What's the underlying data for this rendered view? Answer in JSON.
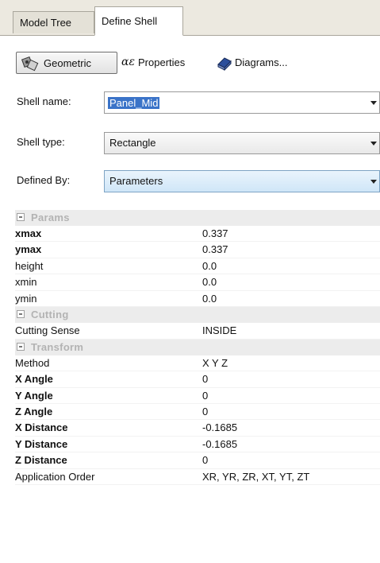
{
  "tabs": [
    {
      "label": "Model Tree",
      "active": false
    },
    {
      "label": "Define Shell",
      "active": true
    }
  ],
  "toolbar": {
    "geometric_label": "Geometric",
    "properties_label": "Properties",
    "properties_icon_glyph": "αε",
    "diagrams_label": "Diagrams..."
  },
  "form": {
    "shell_name": {
      "label": "Shell name:",
      "value": "Panel_Mid"
    },
    "shell_type": {
      "label": "Shell type:",
      "value": "Rectangle"
    },
    "defined_by": {
      "label": "Defined By:",
      "value": "Parameters"
    }
  },
  "property_grid": {
    "params": {
      "title": "Params",
      "rows": [
        {
          "name": "xmax",
          "value": "0.337",
          "bold": true
        },
        {
          "name": "ymax",
          "value": "0.337",
          "bold": true
        },
        {
          "name": "height",
          "value": "0.0",
          "bold": false
        },
        {
          "name": "xmin",
          "value": "0.0",
          "bold": false
        },
        {
          "name": "ymin",
          "value": "0.0",
          "bold": false
        }
      ]
    },
    "cutting": {
      "title": "Cutting",
      "rows": [
        {
          "name": "Cutting Sense",
          "value": "INSIDE",
          "bold": false
        }
      ]
    },
    "transform": {
      "title": "Transform",
      "rows": [
        {
          "name": "Method",
          "value": "X Y Z",
          "bold": false
        },
        {
          "name": "X Angle",
          "value": "0",
          "bold": true
        },
        {
          "name": "Y Angle",
          "value": "0",
          "bold": true
        },
        {
          "name": "Z Angle",
          "value": "0",
          "bold": true
        },
        {
          "name": "X Distance",
          "value": "-0.1685",
          "bold": true
        },
        {
          "name": "Y Distance",
          "value": "-0.1685",
          "bold": true
        },
        {
          "name": "Z Distance",
          "value": "0",
          "bold": true
        },
        {
          "name": "Application Order",
          "value": "XR, YR, ZR, XT, YT, ZT",
          "bold": false
        }
      ]
    }
  },
  "colors": {
    "selection": "#3a73c8",
    "section_bg": "#ececec",
    "section_text": "#b3b3b3"
  }
}
